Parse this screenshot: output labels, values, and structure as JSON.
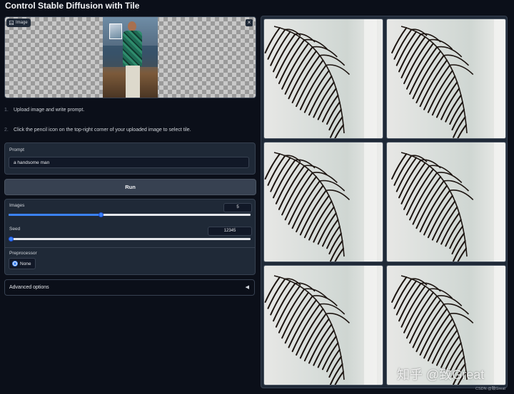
{
  "page": {
    "title": "Control Stable Diffusion with Tile"
  },
  "image_input": {
    "label": "Image",
    "close_icon": "×"
  },
  "steps": [
    {
      "num": "1.",
      "text": "Upload image and write prompt."
    },
    {
      "num": "2.",
      "text": "Click the pencil icon on the top-right corner of your uploaded image to select tile."
    }
  ],
  "prompt": {
    "label": "Prompt",
    "value": "a handsome man"
  },
  "run_button": {
    "label": "Run"
  },
  "images_slider": {
    "label": "Images",
    "value": "5",
    "fraction": 0.38
  },
  "seed_slider": {
    "label": "Seed",
    "value": "12345",
    "fraction": 0.0
  },
  "preprocessor": {
    "label": "Preprocessor",
    "options": [
      "None"
    ],
    "selected": "None"
  },
  "advanced": {
    "label": "Advanced options",
    "arrow": "◀"
  },
  "gallery": {
    "count": 6
  },
  "watermark": {
    "main": "知乎 @致Great",
    "small": "CSDN @致Great"
  }
}
